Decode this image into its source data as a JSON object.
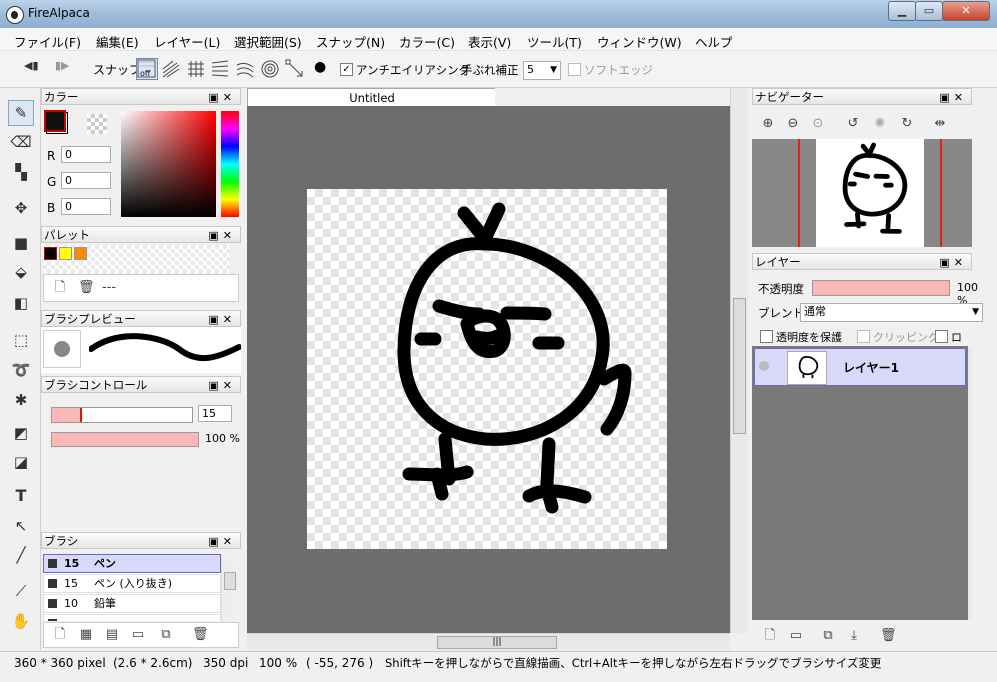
{
  "window": {
    "title": "FireAlpaca",
    "min": "▁",
    "max": "▭",
    "close": "✕"
  },
  "menu": [
    "ファイル(F)",
    "編集(E)",
    "レイヤー(L)",
    "選択範囲(S)",
    "スナップ(N)",
    "カラー(C)",
    "表示(V)",
    "ツール(T)",
    "ウィンドウ(W)",
    "ヘルプ"
  ],
  "toolbar": {
    "snap_label": "スナップ",
    "snap_off": "off",
    "antialias_label": "アンチエイリアシング",
    "antialias_checked": true,
    "stabilizer_label": "手ぶれ補正",
    "stabilizer_value": "5",
    "soft_edge_label": "ソフトエッジ",
    "soft_edge_checked": false
  },
  "color_panel": {
    "title": "カラー",
    "r_label": "R",
    "r_value": "0",
    "g_label": "G",
    "g_value": "0",
    "b_label": "B",
    "b_value": "0",
    "primary_color": "#000000"
  },
  "palette_panel": {
    "title": "パレット",
    "colors": [
      "#000000",
      "#ffff00",
      "#ff8800"
    ],
    "empty_label": "---"
  },
  "brush_preview_panel": {
    "title": "ブラシプレビュー"
  },
  "brush_control_panel": {
    "title": "ブラシコントロール",
    "size_value": "15",
    "opacity_value": "100 %",
    "size_fraction": 0.2,
    "opacity_fraction": 1.0
  },
  "brush_panel": {
    "title": "ブラシ",
    "items": [
      {
        "size": "15",
        "name": "ペン",
        "selected": true
      },
      {
        "size": "15",
        "name": "ペン (入り抜き)",
        "selected": false
      },
      {
        "size": "10",
        "name": "鉛筆",
        "selected": false
      },
      {
        "size": "",
        "name": "",
        "selected": false
      }
    ]
  },
  "canvas": {
    "tab_title": "Untitled"
  },
  "navigator_panel": {
    "title": "ナビゲーター"
  },
  "layer_panel": {
    "title": "レイヤー",
    "opacity_label": "不透明度",
    "opacity_value": "100 %",
    "blend_label": "ブレンド",
    "blend_value": "通常",
    "preserve_alpha_label": "透明度を保護",
    "clipping_label": "クリッピング",
    "lock_label": "ロック",
    "layers": [
      {
        "name": "レイヤー1",
        "selected": true
      }
    ]
  },
  "status": {
    "size": "360 * 360 pixel",
    "cm": "(2.6 * 2.6cm)",
    "dpi": "350 dpi",
    "zoom": "100 %",
    "coords": "( -55, 276 )",
    "hint": "Shiftキーを押しながらで直線描画、Ctrl+Altキーを押しながら左右ドラッグでブラシサイズ変更"
  }
}
